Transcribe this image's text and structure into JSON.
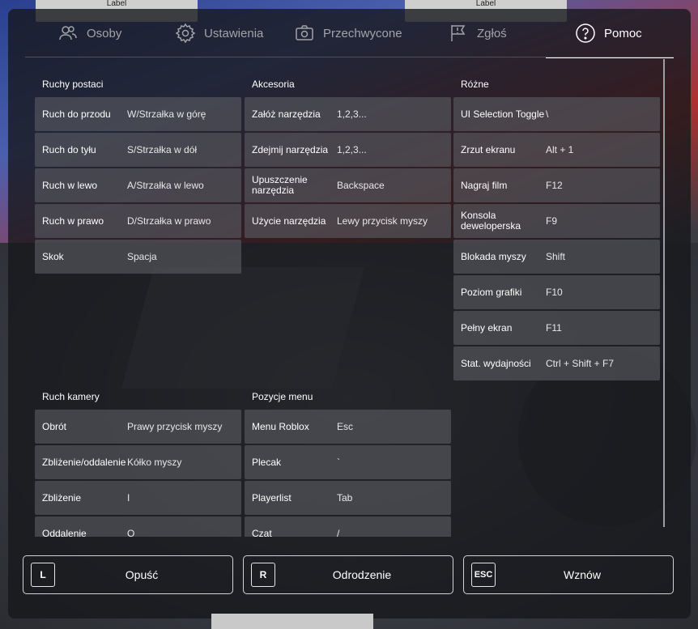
{
  "top_labels": [
    "Label",
    "Label"
  ],
  "tabs": [
    {
      "id": "players",
      "label": "Osoby",
      "icon": "people-icon",
      "active": false
    },
    {
      "id": "settings",
      "label": "Ustawienia",
      "icon": "gear-icon",
      "active": false
    },
    {
      "id": "captures",
      "label": "Przechwycone",
      "icon": "camera-icon",
      "active": false
    },
    {
      "id": "report",
      "label": "Zgłoś",
      "icon": "flag-icon",
      "active": false
    },
    {
      "id": "help",
      "label": "Pomoc",
      "icon": "question-icon",
      "active": true
    }
  ],
  "sections": {
    "movement": {
      "title": "Ruchy postaci",
      "rows": [
        {
          "k": "Ruch do przodu",
          "v": "W/Strzałka w górę"
        },
        {
          "k": "Ruch do tyłu",
          "v": "S/Strzałka w dół"
        },
        {
          "k": "Ruch w lewo",
          "v": "A/Strzałka w lewo"
        },
        {
          "k": "Ruch w prawo",
          "v": "D/Strzałka w prawo"
        },
        {
          "k": "Skok",
          "v": "Spacja"
        }
      ]
    },
    "accessories": {
      "title": "Akcesoria",
      "rows": [
        {
          "k": "Załóż narzędzia",
          "v": "1,2,3..."
        },
        {
          "k": "Zdejmij narzędzia",
          "v": "1,2,3..."
        },
        {
          "k": "Upuszczenie narzędzia",
          "v": "Backspace"
        },
        {
          "k": "Użycie narzędzia",
          "v": "Lewy przycisk myszy"
        }
      ]
    },
    "misc": {
      "title": "Różne",
      "rows": [
        {
          "k": "UI Selection Toggle",
          "v": "\\"
        },
        {
          "k": "Zrzut ekranu",
          "v": "Alt + 1"
        },
        {
          "k": "Nagraj film",
          "v": "F12"
        },
        {
          "k": "Konsola deweloperska",
          "v": "F9"
        },
        {
          "k": "Blokada myszy",
          "v": "Shift"
        },
        {
          "k": "Poziom grafiki",
          "v": "F10"
        },
        {
          "k": "Pełny ekran",
          "v": "F11"
        },
        {
          "k": "Stat. wydajności",
          "v": "Ctrl + Shift + F7"
        }
      ]
    },
    "camera": {
      "title": "Ruch kamery",
      "rows": [
        {
          "k": "Obrót",
          "v": "Prawy przycisk myszy"
        },
        {
          "k": "Zbliżenie/oddalenie",
          "v": "Kółko myszy"
        },
        {
          "k": "Zbliżenie",
          "v": "I"
        },
        {
          "k": "Oddalenie",
          "v": "O"
        }
      ]
    },
    "menu": {
      "title": "Pozycje menu",
      "rows": [
        {
          "k": "Menu Roblox",
          "v": "Esc"
        },
        {
          "k": "Plecak",
          "v": "`"
        },
        {
          "k": "Playerlist",
          "v": "Tab"
        },
        {
          "k": "Czat",
          "v": "/"
        }
      ]
    }
  },
  "buttons": [
    {
      "key": "L",
      "label": "Opuść",
      "name": "leave-button"
    },
    {
      "key": "R",
      "label": "Odrodzenie",
      "name": "respawn-button"
    },
    {
      "key": "ESC",
      "label": "Wznów",
      "name": "resume-button"
    }
  ]
}
